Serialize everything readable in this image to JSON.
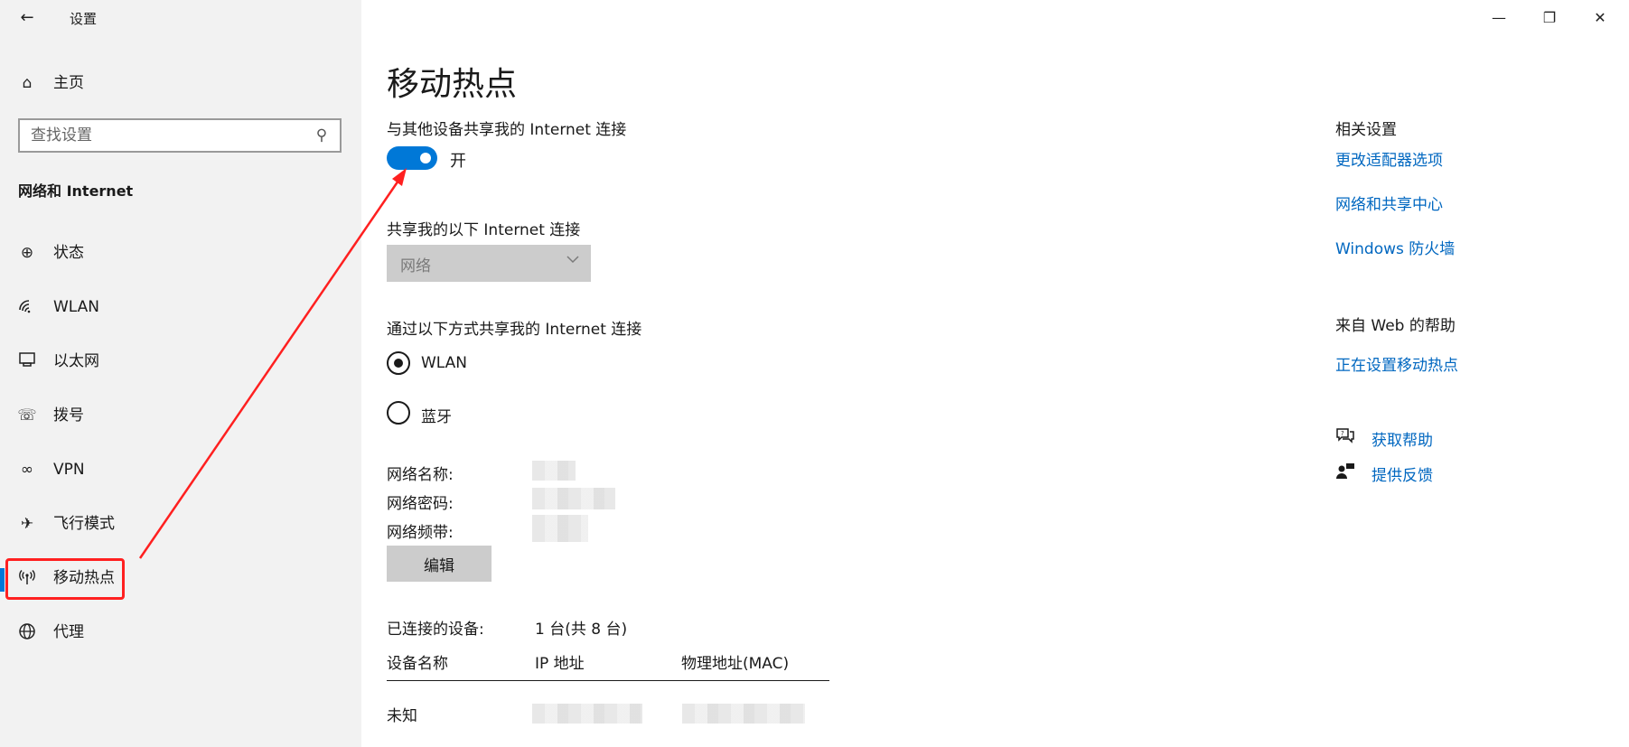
{
  "app": {
    "title": "设置",
    "back_icon": "back-arrow-icon"
  },
  "window_controls": {
    "minimize": "—",
    "restore": "❐",
    "close": "✕"
  },
  "sidebar": {
    "home_label": "主页",
    "search_placeholder": "查找设置",
    "section_title": "网络和 Internet",
    "items": [
      {
        "label": "状态",
        "icon": "status-icon"
      },
      {
        "label": "WLAN",
        "icon": "wifi-icon"
      },
      {
        "label": "以太网",
        "icon": "ethernet-icon"
      },
      {
        "label": "拨号",
        "icon": "dialup-icon"
      },
      {
        "label": "VPN",
        "icon": "vpn-icon"
      },
      {
        "label": "飞行模式",
        "icon": "airplane-icon"
      },
      {
        "label": "移动热点",
        "icon": "hotspot-icon",
        "active": true
      },
      {
        "label": "代理",
        "icon": "globe-icon"
      }
    ]
  },
  "main": {
    "title": "移动热点",
    "share_label": "与其他设备共享我的 Internet 连接",
    "toggle_state": "开",
    "toggle_on": true,
    "share_from_label": "共享我的以下 Internet 连接",
    "share_from_value": "网络",
    "share_over_label": "通过以下方式共享我的 Internet 连接",
    "radio_options": [
      {
        "label": "WLAN",
        "checked": true
      },
      {
        "label": "蓝牙",
        "checked": false
      }
    ],
    "network_name_label": "网络名称:",
    "network_password_label": "网络密码:",
    "network_band_label": "网络频带:",
    "edit_button": "编辑",
    "connected_label": "已连接的设备:",
    "connected_value": "1 台(共 8 台)",
    "table_headers": [
      "设备名称",
      "IP 地址",
      "物理地址(MAC)"
    ],
    "table_rows": [
      {
        "device": "未知"
      }
    ]
  },
  "related": {
    "heading": "相关设置",
    "links": [
      "更改适配器选项",
      "网络和共享中心",
      "Windows 防火墙"
    ],
    "web_help_heading": "来自 Web 的帮助",
    "web_help_link": "正在设置移动热点",
    "get_help": "获取帮助",
    "feedback": "提供反馈"
  },
  "colors": {
    "accent": "#0078d7",
    "link": "#0067c0",
    "annotation": "#ff2020",
    "sidebar_bg": "#f2f2f2"
  }
}
